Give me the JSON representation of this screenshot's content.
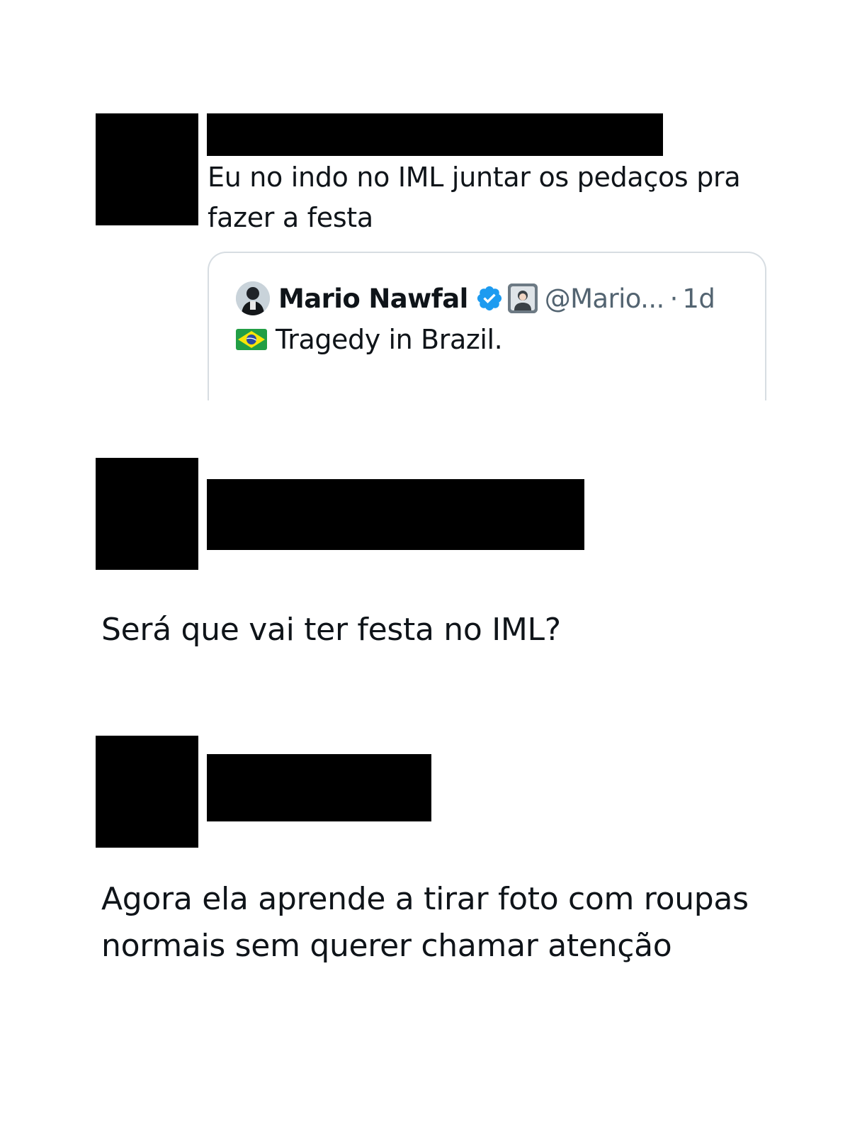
{
  "tweets": [
    {
      "text": "Eu no indo no IML juntar os pedaços pra fazer a festa",
      "quoted": {
        "name": "Mario Nawfal",
        "handle": "@Mario...",
        "separator": "·",
        "time": "1d",
        "text": "Tragedy in Brazil.",
        "flag_icon": "brazil-flag-icon",
        "badge_icon": "verified-badge-icon",
        "badge_color": "#1d9bf0",
        "affiliate_icon": "affiliate-badge-icon"
      }
    },
    {
      "text": "Será que vai ter festa no IML?"
    },
    {
      "text": "Agora ela aprende a tirar foto com roupas normais sem querer chamar atenção"
    }
  ],
  "colors": {
    "text": "#0f1419",
    "secondary_text": "#536471",
    "border": "#d7dde2",
    "redaction": "#000000"
  }
}
